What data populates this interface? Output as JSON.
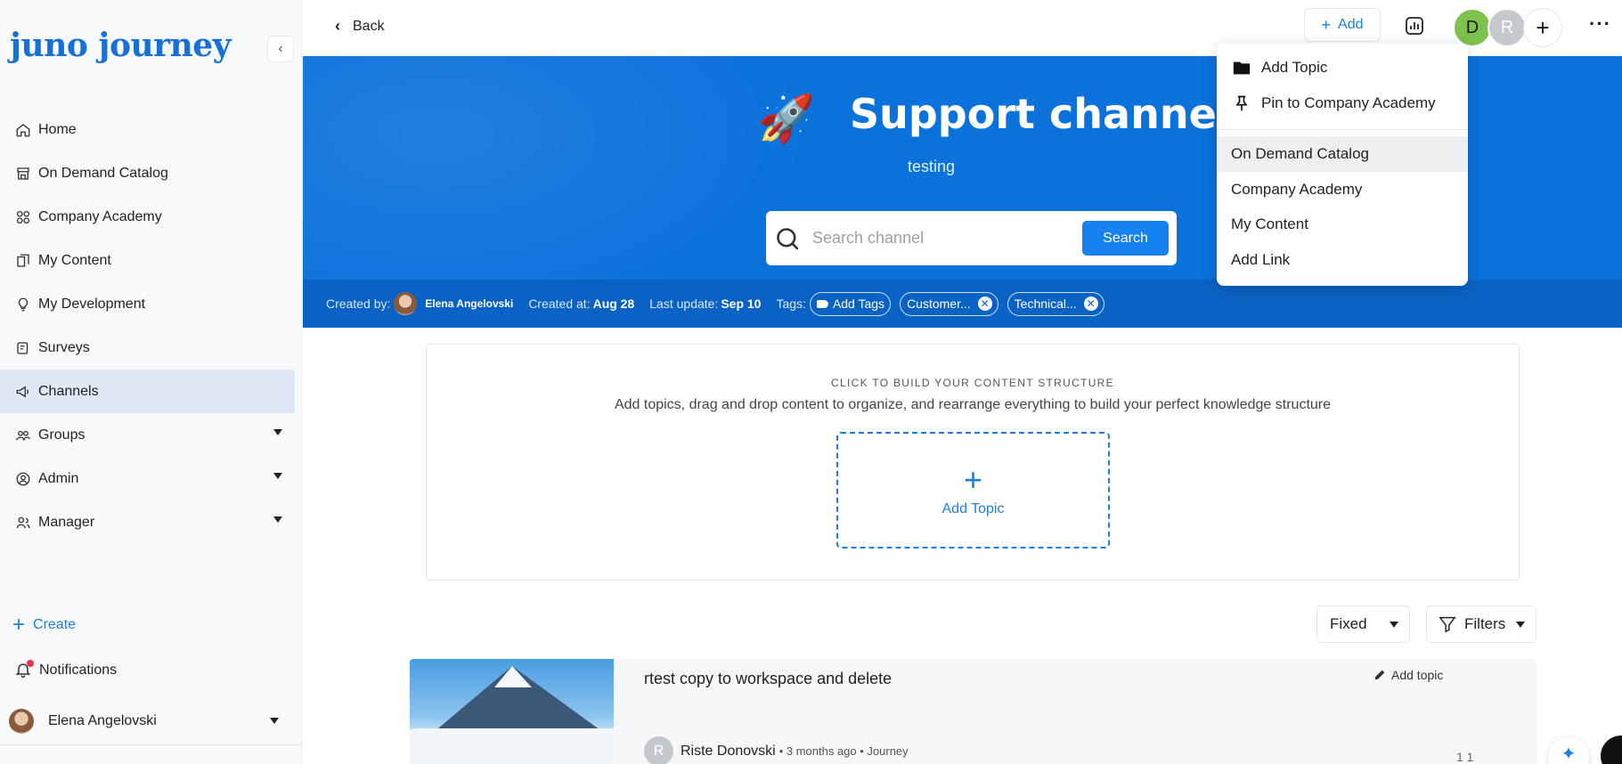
{
  "sidebar": {
    "logo": "juno journey",
    "items": [
      {
        "label": "Home",
        "icon": "home-icon"
      },
      {
        "label": "On Demand Catalog",
        "icon": "store-icon"
      },
      {
        "label": "Company Academy",
        "icon": "grid-icon"
      },
      {
        "label": "My Content",
        "icon": "content-icon"
      },
      {
        "label": "My Development",
        "icon": "lightbulb-icon"
      },
      {
        "label": "Surveys",
        "icon": "survey-icon"
      },
      {
        "label": "Channels",
        "icon": "megaphone-icon",
        "active": true
      },
      {
        "label": "Groups",
        "icon": "users-icon",
        "expandable": true
      },
      {
        "label": "Admin",
        "icon": "user-circle-icon",
        "expandable": true
      },
      {
        "label": "Manager",
        "icon": "manager-icon",
        "expandable": true
      }
    ],
    "create_label": "Create",
    "notifications_label": "Notifications",
    "user_name": "Elena Angelovski"
  },
  "topbar": {
    "back_label": "Back",
    "add_label": "Add",
    "avatar_d": "D",
    "avatar_r": "R",
    "more": "···"
  },
  "banner": {
    "emoji": "🚀",
    "title": "Support channel",
    "subtitle": "testing",
    "search_placeholder": "Search channel",
    "search_button": "Search",
    "meta": {
      "created_by_label": "Created by:",
      "creator": "Elena Angelovski",
      "created_at_label": "Created at:",
      "created_at": "Aug 28",
      "last_update_label": "Last update:",
      "last_update": "Sep 10",
      "tags_label": "Tags:",
      "add_tags": "Add Tags",
      "tags": [
        "Customer...",
        "Technical..."
      ]
    }
  },
  "dropdown": {
    "items": [
      {
        "label": "Add Topic",
        "icon": "folder-icon"
      },
      {
        "label": "Pin to Company Academy",
        "icon": "pin-icon"
      },
      {
        "label": "On Demand Catalog",
        "highlighted": true
      },
      {
        "label": "Company Academy"
      },
      {
        "label": "My Content"
      },
      {
        "label": "Add Link"
      }
    ]
  },
  "builder": {
    "caption": "CLICK TO BUILD YOUR CONTENT STRUCTURE",
    "description": "Add topics, drag and drop content to organize, and rearrange everything to build your perfect knowledge structure",
    "add_topic_label": "Add Topic"
  },
  "controls": {
    "sort_value": "Fixed",
    "filters_label": "Filters"
  },
  "card": {
    "title": "rtest copy to workspace and delete",
    "add_topic": "Add topic",
    "author_initial": "R",
    "author": "Riste Donovski",
    "meta": "• 3 months ago • Journey",
    "counts": "1   1"
  }
}
